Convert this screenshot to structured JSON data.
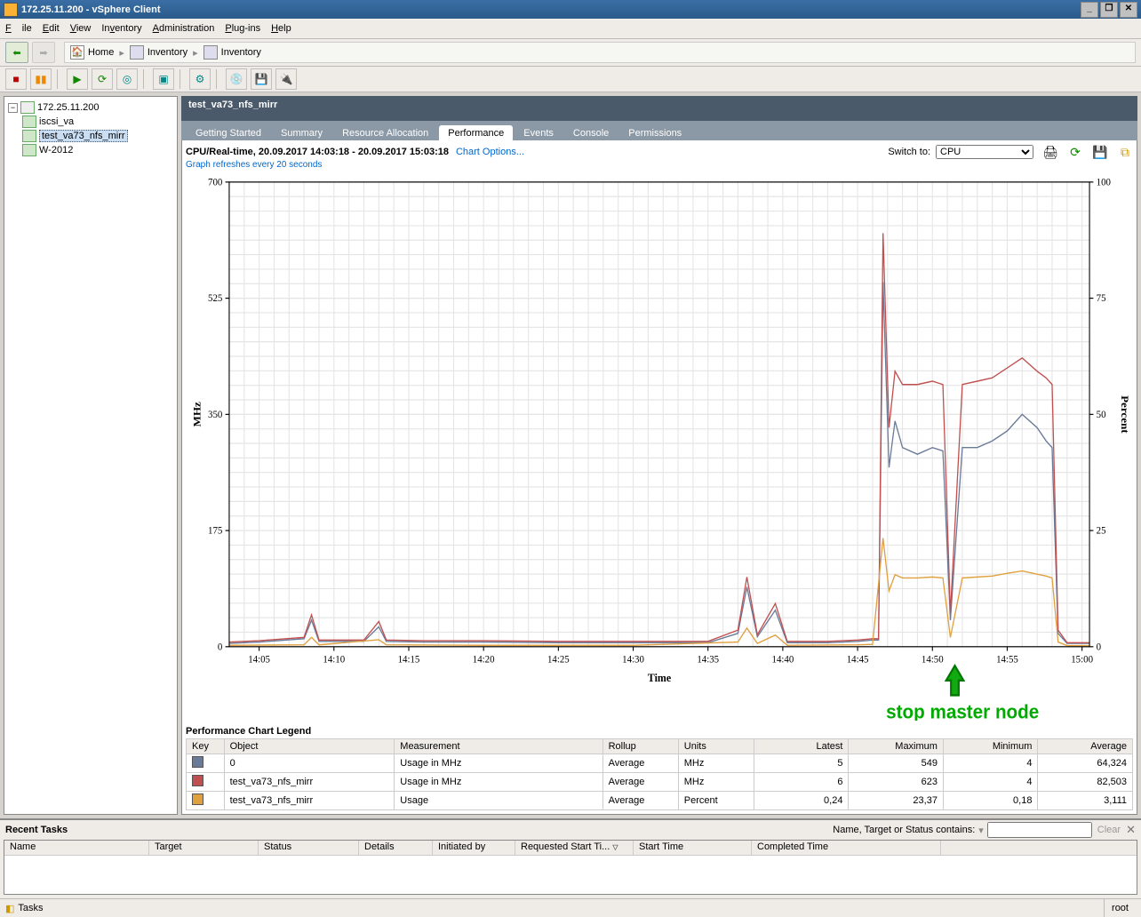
{
  "title": "172.25.11.200 - vSphere Client",
  "menu": {
    "file": "File",
    "edit": "Edit",
    "view": "View",
    "inventory": "Inventory",
    "administration": "Administration",
    "plugins": "Plug-ins",
    "help": "Help"
  },
  "breadcrumb": {
    "home": "Home",
    "inv1": "Inventory",
    "inv2": "Inventory"
  },
  "tree": {
    "root": "172.25.11.200",
    "items": [
      "iscsi_va",
      "test_va73_nfs_mirr",
      "W-2012"
    ],
    "selected": "test_va73_nfs_mirr"
  },
  "page_title": "test_va73_nfs_mirr",
  "tabs": [
    "Getting Started",
    "Summary",
    "Resource Allocation",
    "Performance",
    "Events",
    "Console",
    "Permissions"
  ],
  "active_tab": "Performance",
  "chart_header": {
    "title": "CPU/Real-time, 20.09.2017 14:03:18 - 20.09.2017 15:03:18",
    "options": "Chart Options...",
    "refresh_note": "Graph refreshes every 20 seconds",
    "switch_label": "Switch to:",
    "switch_value": "CPU"
  },
  "annotation": "stop master node",
  "legend_title": "Performance Chart Legend",
  "legend_headers": [
    "Key",
    "Object",
    "Measurement",
    "Rollup",
    "Units",
    "Latest",
    "Maximum",
    "Minimum",
    "Average"
  ],
  "legend_rows": [
    {
      "color": "#6a7a99",
      "object": "0",
      "measurement": "Usage in MHz",
      "rollup": "Average",
      "units": "MHz",
      "latest": "5",
      "maximum": "549",
      "minimum": "4",
      "average": "64,324"
    },
    {
      "color": "#c05050",
      "object": "test_va73_nfs_mirr",
      "measurement": "Usage in MHz",
      "rollup": "Average",
      "units": "MHz",
      "latest": "6",
      "maximum": "623",
      "minimum": "4",
      "average": "82,503"
    },
    {
      "color": "#e0a040",
      "object": "test_va73_nfs_mirr",
      "measurement": "Usage",
      "rollup": "Average",
      "units": "Percent",
      "latest": "0,24",
      "maximum": "23,37",
      "minimum": "0,18",
      "average": "3,111"
    }
  ],
  "recent_tasks": {
    "title": "Recent Tasks",
    "filter_label": "Name, Target or Status contains:",
    "clear": "Clear",
    "columns": [
      "Name",
      "Target",
      "Status",
      "Details",
      "Initiated by",
      "Requested Start Ti...",
      "Start Time",
      "Completed Time"
    ]
  },
  "status": {
    "tasks": "Tasks",
    "user": "root"
  },
  "chart_data": {
    "type": "line",
    "xlabel": "Time",
    "ylabel_left": "MHz",
    "ylabel_right": "Percent",
    "ylim_left": [
      0,
      700
    ],
    "ylim_right": [
      0,
      100
    ],
    "x_ticks": [
      "14:05",
      "14:10",
      "14:15",
      "14:20",
      "14:25",
      "14:30",
      "14:35",
      "14:40",
      "14:45",
      "14:50",
      "14:55",
      "15:00"
    ],
    "y_ticks_left": [
      0,
      175,
      350,
      525,
      700
    ],
    "y_ticks_right": [
      0,
      25,
      50,
      75,
      100
    ],
    "x_domain": [
      3,
      60.5
    ],
    "series": [
      {
        "name": "0 - Usage in MHz",
        "axis": "left",
        "color": "#6a7a99",
        "points": [
          [
            3,
            5
          ],
          [
            5,
            7
          ],
          [
            8,
            12
          ],
          [
            8.5,
            40
          ],
          [
            9,
            8
          ],
          [
            12,
            8
          ],
          [
            13,
            30
          ],
          [
            13.5,
            8
          ],
          [
            16,
            7
          ],
          [
            20,
            7
          ],
          [
            25,
            6
          ],
          [
            30,
            6
          ],
          [
            35,
            6
          ],
          [
            37,
            20
          ],
          [
            37.6,
            90
          ],
          [
            38.3,
            15
          ],
          [
            39.5,
            55
          ],
          [
            40.3,
            6
          ],
          [
            43,
            6
          ],
          [
            45,
            8
          ],
          [
            46,
            10
          ],
          [
            46.4,
            10
          ],
          [
            46.7,
            549
          ],
          [
            47.1,
            270
          ],
          [
            47.5,
            340
          ],
          [
            48,
            300
          ],
          [
            49,
            290
          ],
          [
            50,
            300
          ],
          [
            50.7,
            295
          ],
          [
            51.2,
            40
          ],
          [
            52,
            300
          ],
          [
            53,
            300
          ],
          [
            54,
            310
          ],
          [
            55,
            325
          ],
          [
            56,
            350
          ],
          [
            57,
            330
          ],
          [
            57.6,
            310
          ],
          [
            58,
            300
          ],
          [
            58.4,
            20
          ],
          [
            59,
            5
          ],
          [
            60.5,
            5
          ]
        ]
      },
      {
        "name": "test_va73_nfs_mirr - Usage in MHz",
        "axis": "left",
        "color": "#c05050",
        "points": [
          [
            3,
            7
          ],
          [
            5,
            9
          ],
          [
            8,
            14
          ],
          [
            8.5,
            48
          ],
          [
            9,
            10
          ],
          [
            12,
            10
          ],
          [
            13,
            38
          ],
          [
            13.5,
            10
          ],
          [
            16,
            9
          ],
          [
            20,
            9
          ],
          [
            25,
            8
          ],
          [
            30,
            8
          ],
          [
            35,
            8
          ],
          [
            37,
            25
          ],
          [
            37.6,
            105
          ],
          [
            38.3,
            18
          ],
          [
            39.5,
            65
          ],
          [
            40.3,
            8
          ],
          [
            43,
            8
          ],
          [
            45,
            10
          ],
          [
            46,
            12
          ],
          [
            46.4,
            12
          ],
          [
            46.7,
            623
          ],
          [
            47.1,
            330
          ],
          [
            47.5,
            415
          ],
          [
            48,
            395
          ],
          [
            49,
            395
          ],
          [
            50,
            400
          ],
          [
            50.7,
            395
          ],
          [
            51.2,
            50
          ],
          [
            52,
            395
          ],
          [
            53,
            400
          ],
          [
            54,
            405
          ],
          [
            55,
            420
          ],
          [
            56,
            435
          ],
          [
            57,
            415
          ],
          [
            57.6,
            405
          ],
          [
            58,
            395
          ],
          [
            58.4,
            25
          ],
          [
            59,
            6
          ],
          [
            60.5,
            6
          ]
        ]
      },
      {
        "name": "test_va73_nfs_mirr - Usage",
        "axis": "right",
        "color": "#e0a040",
        "points": [
          [
            3,
            0.3
          ],
          [
            8,
            0.4
          ],
          [
            8.5,
            2
          ],
          [
            9,
            0.4
          ],
          [
            13,
            1.5
          ],
          [
            13.5,
            0.4
          ],
          [
            20,
            0.3
          ],
          [
            30,
            0.3
          ],
          [
            37,
            1
          ],
          [
            37.6,
            4
          ],
          [
            38.3,
            0.7
          ],
          [
            39.5,
            2.5
          ],
          [
            40.3,
            0.3
          ],
          [
            45,
            0.4
          ],
          [
            46,
            0.5
          ],
          [
            46.7,
            23.37
          ],
          [
            47.1,
            12
          ],
          [
            47.5,
            15.5
          ],
          [
            48,
            14.8
          ],
          [
            49,
            14.8
          ],
          [
            50,
            15
          ],
          [
            50.7,
            14.8
          ],
          [
            51.2,
            2
          ],
          [
            52,
            14.8
          ],
          [
            53,
            15
          ],
          [
            54,
            15.2
          ],
          [
            55,
            15.8
          ],
          [
            56,
            16.3
          ],
          [
            57,
            15.6
          ],
          [
            57.6,
            15.2
          ],
          [
            58,
            14.8
          ],
          [
            58.4,
            1
          ],
          [
            59,
            0.24
          ],
          [
            60.5,
            0.24
          ]
        ]
      }
    ]
  }
}
